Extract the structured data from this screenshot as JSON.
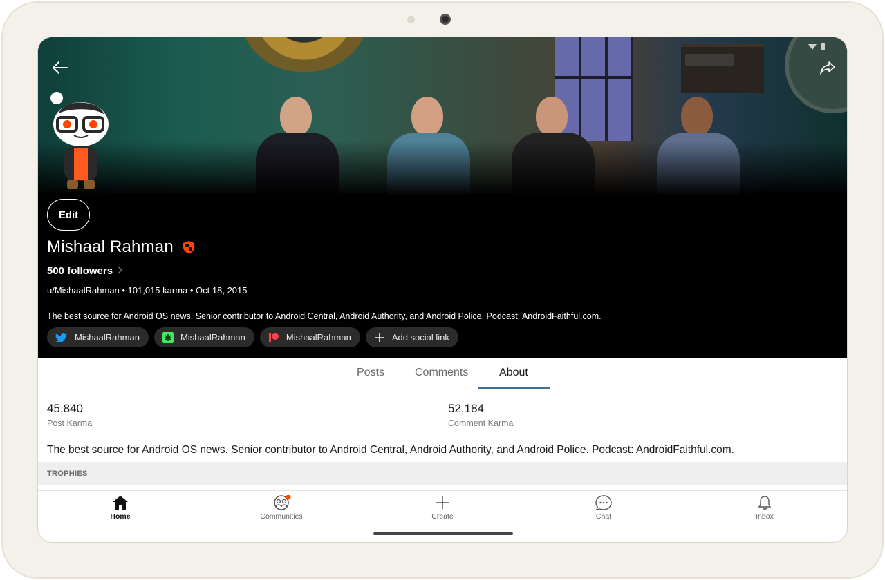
{
  "profile": {
    "edit_label": "Edit",
    "name": "Mishaal Rahman",
    "followers": "500 followers",
    "meta": "u/MishaalRahman • 101,015 karma • Oct 18, 2015",
    "bio": "The best source for Android OS news. Senior contributor to Android Central, Android Authority, and Android Police. Podcast: AndroidFaithful.com."
  },
  "social_links": [
    {
      "label": "MishaalRahman",
      "icon": "twitter-icon",
      "color": "#1d9bf0"
    },
    {
      "label": "MishaalRahman",
      "icon": "linktree-icon",
      "color": "#43e660"
    },
    {
      "label": "MishaalRahman",
      "icon": "patreon-icon",
      "color": "#ff424d"
    },
    {
      "label": "Add social link",
      "icon": "plus-icon",
      "color": "#ffffff"
    }
  ],
  "tabs": [
    {
      "label": "Posts"
    },
    {
      "label": "Comments"
    },
    {
      "label": "About"
    }
  ],
  "active_tab": "About",
  "about": {
    "post_karma_value": "45,840",
    "post_karma_label": "Post Karma",
    "comment_karma_value": "52,184",
    "comment_karma_label": "Comment Karma",
    "bio": "The best source for Android OS news. Senior contributor to Android Central, Android Authority, and Android Police. Podcast: AndroidFaithful.com.",
    "trophies_header": "TROPHIES"
  },
  "bottom_nav": [
    {
      "label": "Home",
      "icon": "home-icon"
    },
    {
      "label": "Communities",
      "icon": "communities-icon"
    },
    {
      "label": "Create",
      "icon": "plus-icon"
    },
    {
      "label": "Chat",
      "icon": "chat-icon"
    },
    {
      "label": "Inbox",
      "icon": "bell-icon"
    }
  ],
  "colors": {
    "accent_underline": "#3f6f93",
    "notification_dot": "#ff4500",
    "header_bg": "#000000"
  }
}
